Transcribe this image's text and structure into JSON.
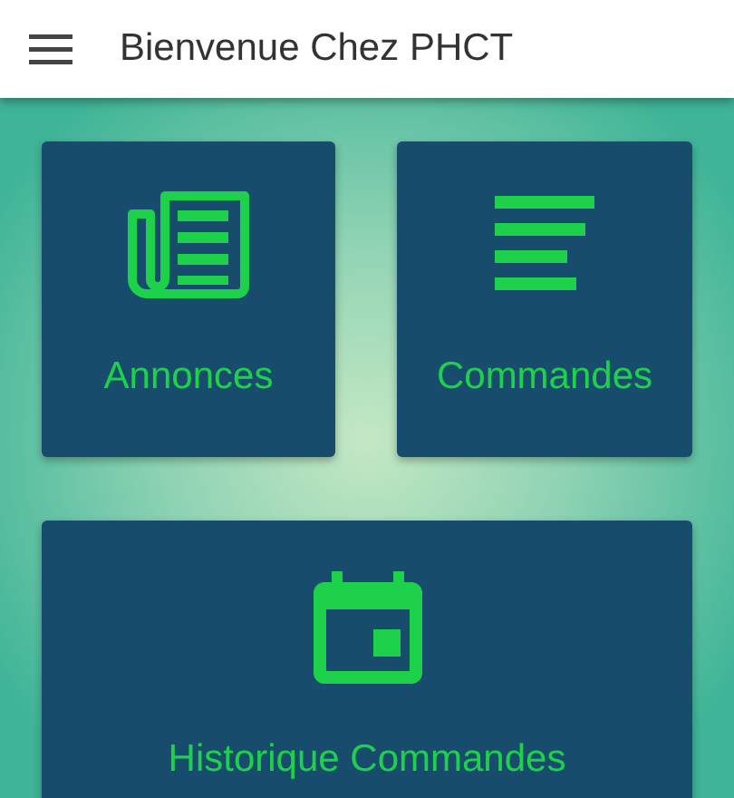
{
  "app_bar": {
    "title": "Bienvenue Chez PHCT"
  },
  "tiles": [
    {
      "label": "Annonces",
      "kind": "newspaper"
    },
    {
      "label": "Commandes",
      "kind": "list"
    },
    {
      "label": "Historique Commandes",
      "kind": "calendar"
    }
  ]
}
